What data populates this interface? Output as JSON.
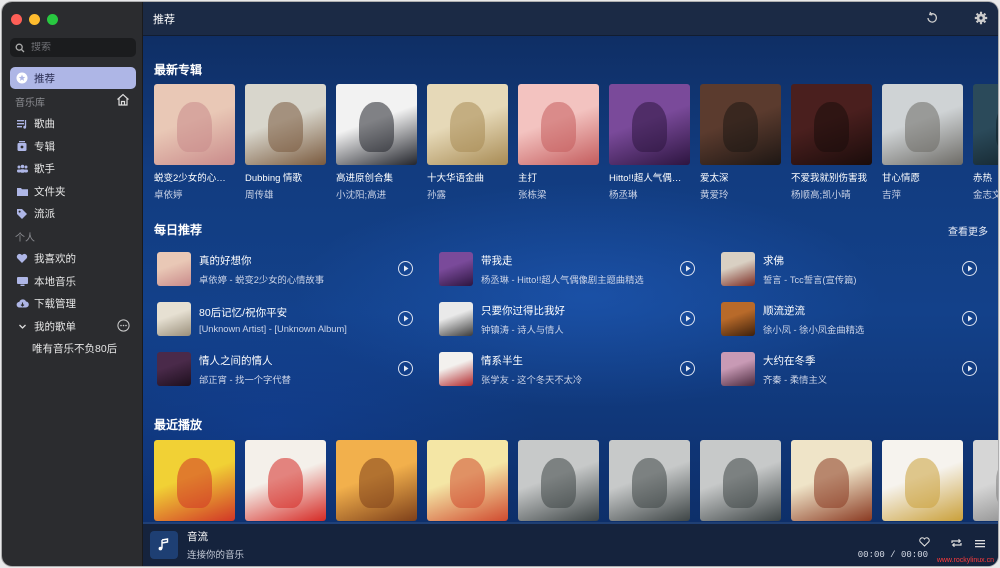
{
  "sidebar": {
    "search_placeholder": "搜索",
    "items": [
      {
        "label": "推荐",
        "icon": "recommend-icon",
        "active": true
      },
      {
        "section": "音乐库"
      },
      {
        "label": "歌曲",
        "icon": "songs-icon"
      },
      {
        "label": "专辑",
        "icon": "album-icon"
      },
      {
        "label": "歌手",
        "icon": "artist-icon"
      },
      {
        "label": "文件夹",
        "icon": "folder-icon"
      },
      {
        "label": "流派",
        "icon": "genre-tag-icon"
      },
      {
        "section": "个人"
      },
      {
        "label": "我喜欢的",
        "icon": "heart-icon"
      },
      {
        "label": "本地音乐",
        "icon": "computer-icon"
      },
      {
        "label": "下载管理",
        "icon": "download-cloud-icon"
      },
      {
        "label": "我的歌单",
        "icon": "chevron-down-icon"
      },
      {
        "label": "唯有音乐不负80后"
      }
    ]
  },
  "header": {
    "title": "推荐"
  },
  "new_albums": {
    "title": "最新专辑",
    "items": [
      {
        "name": "蜕变2少女的心情故事",
        "artist": "卓依婷",
        "colors": [
          "#e9c8b6",
          "#c98a8a"
        ]
      },
      {
        "name": "Dubbing 情歌",
        "artist": "周传雄",
        "colors": [
          "#d8d6cc",
          "#7a5a3e"
        ]
      },
      {
        "name": "高进原创合集",
        "artist": "小沈阳;高进",
        "colors": [
          "#f2f2f2",
          "#23252c"
        ]
      },
      {
        "name": "十大华语金曲",
        "artist": "孙露",
        "colors": [
          "#e6d9b8",
          "#a88b54"
        ]
      },
      {
        "name": "主打",
        "artist": "张栋梁",
        "colors": [
          "#f3c3c0",
          "#c45c5d"
        ]
      },
      {
        "name": "Hitto!!超人气偶像剧主题曲精选",
        "artist": "杨丞琳",
        "colors": [
          "#7a4a9a",
          "#2d1540"
        ]
      },
      {
        "name": "爱太深",
        "artist": "黄爱玲",
        "colors": [
          "#5b3b2e",
          "#1e1714"
        ]
      },
      {
        "name": "不爱我就别伤害我",
        "artist": "杨顺高;凯小晴",
        "colors": [
          "#4a1f1e",
          "#1a0c0b"
        ]
      },
      {
        "name": "甘心情愿",
        "artist": "吉萍",
        "colors": [
          "#cfd3d5",
          "#6d6b66"
        ]
      },
      {
        "name": "赤热",
        "artist": "金志文",
        "colors": [
          "#2b4a5a",
          "#0f1d24"
        ]
      }
    ]
  },
  "daily": {
    "title": "每日推荐",
    "see_more": "查看更多",
    "songs": [
      {
        "title": "真的好想你",
        "subtitle": "卓依婷 - 蜕变2少女的心情故事",
        "colors": [
          "#e9c8b6",
          "#c98a8a"
        ]
      },
      {
        "title": "带我走",
        "subtitle": "杨丞琳 - Hitto!!超人气偶像剧主题曲精选",
        "colors": [
          "#7a4a9a",
          "#2d1540"
        ]
      },
      {
        "title": "求佛",
        "subtitle": "誓言 - Tcc誓言(宣传篇)",
        "colors": [
          "#d9d0c3",
          "#7c2b22"
        ]
      },
      {
        "title": "80后记忆/祝你平安",
        "subtitle": "[Unknown Artist] - [Unknown Album]",
        "colors": [
          "#e6e0d2",
          "#9a8f7b"
        ]
      },
      {
        "title": "只要你过得比我好",
        "subtitle": "钟镇涛 - 诗人与情人",
        "colors": [
          "#e9e9e9",
          "#3a3a3a"
        ]
      },
      {
        "title": "顺流逆流",
        "subtitle": "徐小凤 - 徐小凤金曲精选",
        "colors": [
          "#b86a2a",
          "#3d200b"
        ]
      },
      {
        "title": "情人之间的情人",
        "subtitle": "邰正宵 - 找一个字代替",
        "colors": [
          "#4a2a4a",
          "#1d0f1d"
        ]
      },
      {
        "title": "情系半生",
        "subtitle": "张学友 - 这个冬天不太冷",
        "colors": [
          "#f3f1ee",
          "#b2272b"
        ]
      },
      {
        "title": "大约在冬季",
        "subtitle": "齐秦 - 柔情主义",
        "colors": [
          "#c89ab5",
          "#4b2a3e"
        ]
      }
    ]
  },
  "recent": {
    "title": "最近播放",
    "items": [
      {
        "colors": [
          "#f1d135",
          "#d13627"
        ]
      },
      {
        "colors": [
          "#f4f0ea",
          "#d62a25"
        ]
      },
      {
        "colors": [
          "#f2b04c",
          "#7d3f1a"
        ]
      },
      {
        "colors": [
          "#f4e6a5",
          "#d04a2f"
        ]
      },
      {
        "colors": [
          "#c7c9c9",
          "#3e4546"
        ]
      },
      {
        "colors": [
          "#c7c9c9",
          "#3e4546"
        ]
      },
      {
        "colors": [
          "#c7c9c9",
          "#3e4546"
        ]
      },
      {
        "colors": [
          "#efe4c8",
          "#8a3a22"
        ]
      },
      {
        "colors": [
          "#f6f3ee",
          "#caa03a"
        ]
      },
      {
        "colors": [
          "#d6d6d6",
          "#7b7b7b"
        ]
      }
    ]
  },
  "player": {
    "title": "音流",
    "subtitle": "连接你的音乐",
    "time": "00:00 / 00:00",
    "progress": 0
  },
  "watermark": "www.rockylinux.cn",
  "colors": {
    "accent": "#aeb6e6",
    "sidebar_bg": "#2b2c2f",
    "main_bg": "#123c80"
  }
}
